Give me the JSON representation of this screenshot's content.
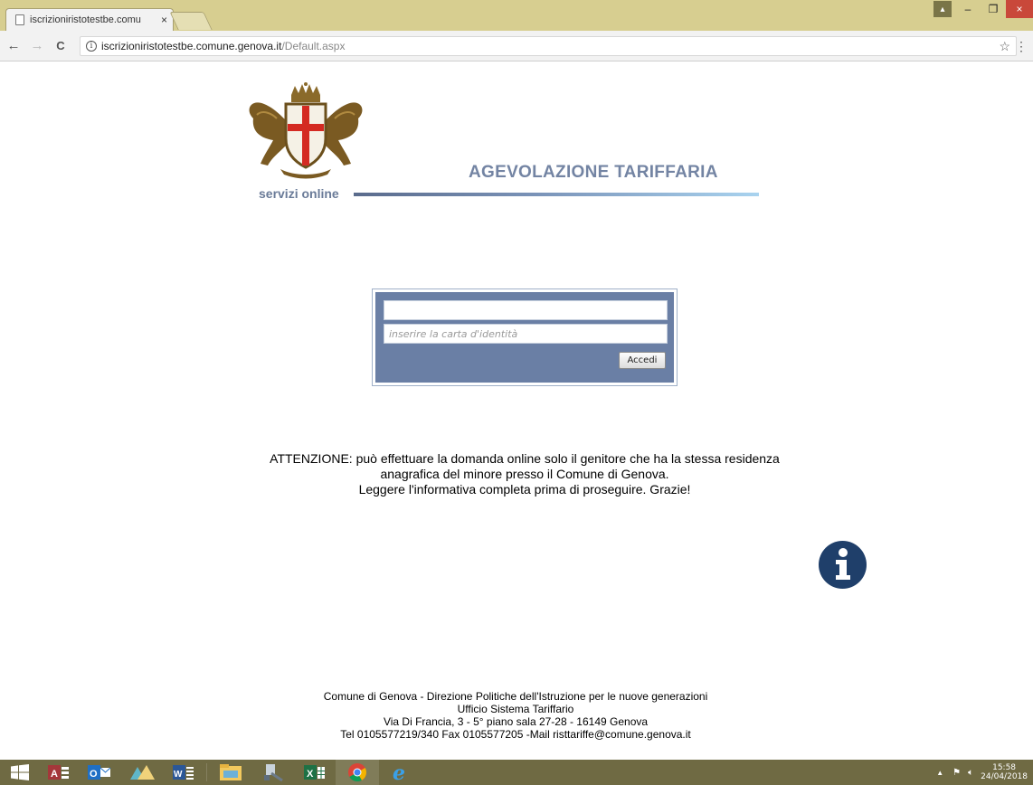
{
  "browser": {
    "tab_title": "iscrizioniristotestbe.comu",
    "tab_close": "×",
    "url_host": "iscrizioniristotestbe.comune.genova.it",
    "url_path": "/Default.aspx",
    "back": "←",
    "forward": "→",
    "reload": "C",
    "star": "☆",
    "menu": "⋮"
  },
  "window_controls": {
    "minimize": "–",
    "maximize": "❐",
    "close": "×"
  },
  "header": {
    "servizi": "servizi online",
    "title": "AGEVOLAZIONE TARIFFARIA"
  },
  "login": {
    "username_value": "",
    "username_placeholder": "",
    "password_placeholder": "inserire la carta d'identità",
    "submit_label": "Accedi"
  },
  "notice": {
    "line1": "ATTENZIONE: può effettuare la domanda online solo il genitore che ha la stessa residenza",
    "line2": "anagrafica del minore presso il Comune di Genova.",
    "line3": "Leggere l'informativa completa prima di proseguire. Grazie!"
  },
  "footer": {
    "line1": "Comune di Genova - Direzione Politiche dell'Istruzione per le nuove generazioni",
    "line2": "Ufficio Sistema Tariffario",
    "line3": "Via Di Francia, 3 - 5° piano sala 27-28 - 16149 Genova",
    "line4": "Tel 0105577219/340 Fax 0105577205 -Mail risttariffe@comune.genova.it"
  },
  "taskbar": {
    "apps": [
      "windows-start",
      "access",
      "outlook",
      "photos",
      "word",
      "file-explorer",
      "tools",
      "excel",
      "chrome",
      "internet-explorer"
    ],
    "time": "15:58",
    "date": "24/04/2018"
  },
  "colors": {
    "login_panel": "#6a7fa5",
    "brand_text": "#7384a3",
    "taskbar": "#6f6a43",
    "titlebar": "#d7ce90"
  }
}
